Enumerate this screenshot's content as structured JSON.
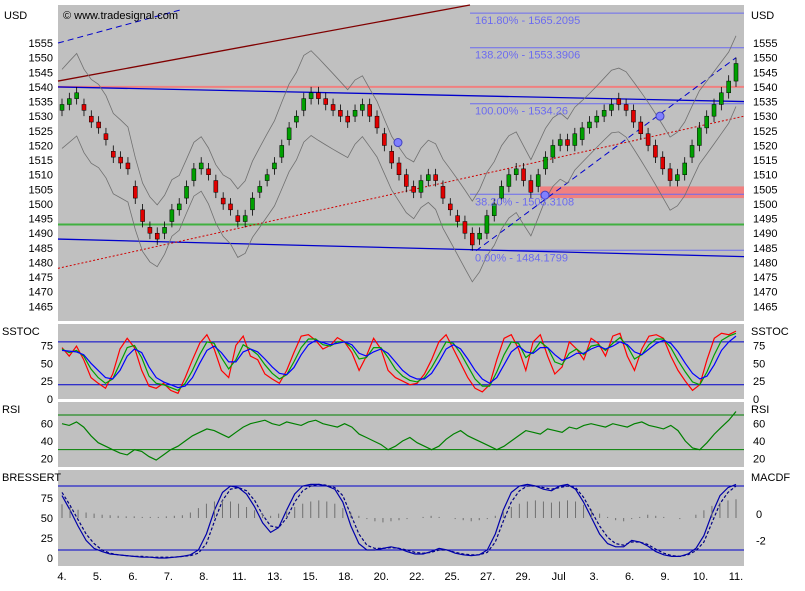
{
  "price_panel": {
    "currency": "USD",
    "copyright": "© www.tradesignal.com",
    "ylim": [
      1460,
      1568
    ],
    "y_ticks": [
      1465,
      1470,
      1475,
      1480,
      1485,
      1490,
      1495,
      1500,
      1505,
      1510,
      1515,
      1520,
      1525,
      1530,
      1535,
      1540,
      1545,
      1550,
      1555
    ],
    "fib_levels": [
      {
        "label": "161.80% - 1565.2095",
        "value": 1565.2095
      },
      {
        "label": "138.20% - 1553.3906",
        "value": 1553.3906
      },
      {
        "label": "100.00% - 1534.26",
        "value": 1534.26
      },
      {
        "label": "38.20% - 1503.3108",
        "value": 1503.3108
      },
      {
        "label": "0.00% - 1484.1799",
        "value": 1484.1799
      }
    ],
    "colors": {
      "up": "#00a000",
      "down": "#e00000",
      "trend_blue": "#0000cc",
      "trend_red_dark": "#800000",
      "support_green": "#40b040",
      "resistance_band": "#f08080",
      "bollinger": "#707070"
    }
  },
  "sstoc_panel": {
    "label": "SSTOC",
    "ylim": [
      0,
      105
    ],
    "y_ticks": [
      0,
      25,
      50,
      75
    ],
    "levels": [
      20,
      80
    ],
    "series": [
      {
        "color": "#ff0000",
        "values": [
          72,
          60,
          74,
          55,
          30,
          22,
          15,
          35,
          70,
          85,
          72,
          40,
          18,
          15,
          22,
          12,
          8,
          30,
          55,
          78,
          90,
          70,
          40,
          30,
          75,
          88,
          60,
          55,
          35,
          28,
          22,
          40,
          65,
          88,
          90,
          82,
          70,
          75,
          86,
          80,
          65,
          40,
          60,
          85,
          70,
          40,
          30,
          25,
          20,
          22,
          35,
          55,
          80,
          90,
          70,
          50,
          30,
          15,
          10,
          20,
          55,
          85,
          90,
          70,
          40,
          80,
          90,
          60,
          35,
          45,
          80,
          70,
          55,
          85,
          78,
          60,
          88,
          92,
          60,
          40,
          70,
          88,
          90,
          85,
          60,
          40,
          25,
          12,
          20,
          55,
          85,
          92,
          90,
          95
        ]
      },
      {
        "color": "#00a000",
        "values": [
          70,
          65,
          68,
          60,
          42,
          30,
          22,
          28,
          50,
          72,
          75,
          58,
          32,
          22,
          20,
          16,
          12,
          22,
          40,
          62,
          80,
          78,
          58,
          42,
          55,
          76,
          70,
          62,
          48,
          36,
          28,
          34,
          52,
          72,
          84,
          84,
          76,
          74,
          80,
          80,
          72,
          56,
          58,
          72,
          72,
          58,
          42,
          32,
          26,
          24,
          30,
          44,
          62,
          80,
          78,
          64,
          46,
          28,
          18,
          18,
          38,
          62,
          80,
          78,
          58,
          66,
          80,
          72,
          52,
          48,
          64,
          70,
          62,
          74,
          76,
          68,
          78,
          86,
          74,
          56,
          62,
          76,
          84,
          84,
          72,
          54,
          38,
          24,
          20,
          38,
          62,
          82,
          88,
          92
        ]
      },
      {
        "color": "#0000ff",
        "values": [
          68,
          67,
          66,
          62,
          50,
          40,
          30,
          28,
          40,
          60,
          70,
          65,
          45,
          30,
          24,
          20,
          16,
          18,
          30,
          50,
          68,
          74,
          65,
          52,
          52,
          66,
          70,
          66,
          56,
          45,
          36,
          34,
          44,
          62,
          76,
          82,
          79,
          76,
          78,
          80,
          76,
          64,
          60,
          66,
          70,
          64,
          52,
          40,
          32,
          28,
          28,
          36,
          52,
          70,
          76,
          70,
          56,
          40,
          28,
          22,
          30,
          48,
          66,
          74,
          66,
          64,
          72,
          72,
          62,
          54,
          58,
          64,
          64,
          70,
          74,
          70,
          74,
          80,
          76,
          66,
          62,
          70,
          78,
          82,
          78,
          66,
          50,
          36,
          28,
          32,
          48,
          68,
          80,
          88
        ]
      }
    ]
  },
  "rsi_panel": {
    "label": "RSI",
    "ylim": [
      10,
      85
    ],
    "y_ticks": [
      20,
      40,
      60
    ],
    "levels": [
      30,
      70
    ],
    "color": "#008000",
    "values": [
      60,
      58,
      62,
      56,
      46,
      38,
      34,
      30,
      26,
      24,
      30,
      28,
      22,
      18,
      24,
      30,
      34,
      40,
      46,
      50,
      54,
      52,
      48,
      44,
      50,
      56,
      60,
      62,
      64,
      60,
      58,
      62,
      60,
      58,
      62,
      64,
      60,
      58,
      56,
      60,
      56,
      48,
      44,
      40,
      36,
      30,
      34,
      40,
      44,
      38,
      34,
      30,
      34,
      42,
      48,
      52,
      46,
      42,
      38,
      34,
      30,
      34,
      40,
      46,
      52,
      50,
      48,
      54,
      52,
      50,
      56,
      54,
      58,
      60,
      58,
      56,
      60,
      58,
      56,
      60,
      62,
      58,
      56,
      54,
      58,
      52,
      40,
      32,
      30,
      38,
      48,
      56,
      64,
      74
    ]
  },
  "macd_panel": {
    "label_left": "BRESSERT",
    "label_right": "MACDF",
    "ylim_left": [
      -10,
      110
    ],
    "y_ticks_left": [
      0,
      25,
      50,
      75
    ],
    "levels_left": [
      10,
      90
    ],
    "y_ticks_right": [
      {
        "label": "0",
        "v": 55
      },
      {
        "label": "-2",
        "v": 22
      }
    ],
    "bressert_solid": [
      78,
      60,
      40,
      22,
      12,
      8,
      5,
      4,
      3,
      2,
      1,
      1,
      0,
      0,
      1,
      2,
      4,
      10,
      30,
      60,
      82,
      90,
      88,
      80,
      64,
      44,
      32,
      38,
      60,
      80,
      90,
      92,
      92,
      90,
      86,
      70,
      40,
      18,
      10,
      10,
      12,
      14,
      12,
      8,
      5,
      5,
      8,
      12,
      10,
      6,
      4,
      3,
      4,
      10,
      30,
      60,
      82,
      90,
      92,
      90,
      86,
      84,
      90,
      92,
      86,
      70,
      50,
      30,
      18,
      14,
      14,
      22,
      20,
      15,
      8,
      4,
      2,
      2,
      5,
      12,
      28,
      55,
      78,
      88,
      92
    ],
    "bressert_dashed": [
      82,
      66,
      48,
      30,
      18,
      10,
      6,
      4,
      3,
      2,
      2,
      1,
      1,
      1,
      1,
      2,
      3,
      6,
      18,
      46,
      72,
      86,
      88,
      84,
      72,
      54,
      40,
      38,
      50,
      70,
      84,
      90,
      92,
      91,
      88,
      78,
      54,
      30,
      16,
      12,
      12,
      13,
      12,
      10,
      7,
      6,
      7,
      10,
      10,
      7,
      5,
      4,
      4,
      7,
      20,
      46,
      70,
      84,
      90,
      90,
      88,
      86,
      88,
      90,
      88,
      76,
      58,
      40,
      26,
      18,
      16,
      20,
      20,
      17,
      11,
      6,
      3,
      2,
      4,
      9,
      20,
      44,
      68,
      82,
      90
    ],
    "hist": [
      25,
      20,
      15,
      10,
      8,
      6,
      5,
      4,
      3,
      3,
      2,
      2,
      2,
      3,
      4,
      5,
      10,
      18,
      26,
      30,
      32,
      30,
      26,
      20,
      14,
      8,
      4,
      8,
      14,
      20,
      26,
      30,
      32,
      30,
      26,
      18,
      10,
      4,
      -2,
      -6,
      -8,
      -6,
      -4,
      -2,
      0,
      2,
      4,
      2,
      0,
      -2,
      -4,
      -6,
      -4,
      -2,
      4,
      12,
      20,
      26,
      30,
      32,
      30,
      28,
      30,
      32,
      30,
      24,
      16,
      8,
      2,
      -4,
      -6,
      -2,
      2,
      6,
      4,
      2,
      0,
      -2,
      0,
      6,
      14,
      22,
      28,
      32,
      34
    ]
  },
  "chart_data": [
    {
      "type": "candlestick",
      "title": "",
      "ylabel": "USD",
      "ylim": [
        1460,
        1568
      ],
      "x_tick_labels": [
        "4.",
        "5.",
        "6.",
        "7.",
        "8.",
        "11.",
        "13.",
        "15.",
        "18.",
        "20.",
        "22.",
        "25.",
        "27.",
        "29.",
        "Jul",
        "3.",
        "6.",
        "9.",
        "10.",
        "11."
      ],
      "close": [
        1534,
        1536,
        1538,
        1532,
        1528,
        1526,
        1522,
        1516,
        1514,
        1512,
        1502,
        1494,
        1490,
        1488,
        1492,
        1498,
        1500,
        1506,
        1512,
        1514,
        1510,
        1504,
        1500,
        1498,
        1494,
        1496,
        1502,
        1506,
        1510,
        1514,
        1520,
        1526,
        1530,
        1536,
        1538,
        1536,
        1534,
        1532,
        1530,
        1528,
        1532,
        1534,
        1530,
        1526,
        1520,
        1514,
        1510,
        1506,
        1504,
        1508,
        1510,
        1508,
        1502,
        1498,
        1494,
        1490,
        1486,
        1490,
        1496,
        1500,
        1506,
        1510,
        1512,
        1508,
        1504,
        1510,
        1516,
        1520,
        1522,
        1520,
        1524,
        1526,
        1528,
        1530,
        1532,
        1534,
        1534,
        1532,
        1528,
        1524,
        1520,
        1516,
        1512,
        1508,
        1510,
        1514,
        1520,
        1526,
        1530,
        1534,
        1538,
        1542,
        1548
      ],
      "open": [
        1532,
        1534,
        1536,
        1534,
        1530,
        1528,
        1524,
        1518,
        1516,
        1514,
        1506,
        1498,
        1492,
        1490,
        1490,
        1494,
        1498,
        1502,
        1508,
        1512,
        1512,
        1508,
        1502,
        1500,
        1496,
        1494,
        1498,
        1504,
        1508,
        1512,
        1516,
        1522,
        1528,
        1532,
        1536,
        1538,
        1536,
        1534,
        1532,
        1530,
        1530,
        1532,
        1534,
        1530,
        1524,
        1518,
        1514,
        1510,
        1506,
        1504,
        1508,
        1510,
        1506,
        1500,
        1496,
        1494,
        1490,
        1488,
        1490,
        1496,
        1502,
        1506,
        1510,
        1512,
        1508,
        1506,
        1512,
        1516,
        1520,
        1522,
        1520,
        1522,
        1526,
        1528,
        1530,
        1532,
        1536,
        1534,
        1532,
        1528,
        1524,
        1520,
        1516,
        1512,
        1508,
        1510,
        1516,
        1520,
        1526,
        1530,
        1534,
        1538,
        1542
      ]
    },
    {
      "type": "line",
      "title": "SSTOC",
      "ylim": [
        0,
        105
      ]
    },
    {
      "type": "line",
      "title": "RSI",
      "ylim": [
        10,
        85
      ]
    },
    {
      "type": "line",
      "title": "BRESSERT / MACDF",
      "ylim": [
        -10,
        110
      ]
    }
  ]
}
